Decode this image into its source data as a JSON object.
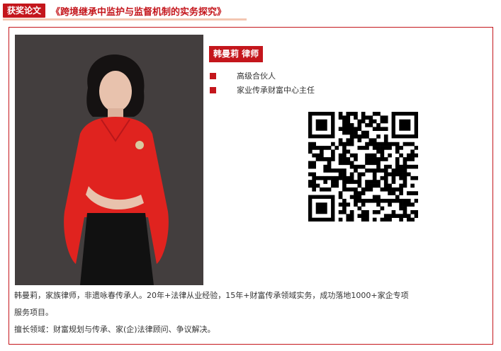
{
  "header": {
    "badge_label": "获奖论文",
    "article_title": "《跨境继承中监护与监督机制的实务探究》"
  },
  "profile": {
    "name_tag": "韩曼莉 律师",
    "roles": [
      "高级合伙人",
      "家业传承财富中心主任"
    ],
    "bio_line1": "韩曼莉，家族律师，非遗咏春传承人。20年+法律从业经验，15年+财富传承领域实务，成功落地1000+家企专项",
    "bio_line2": "服务项目。",
    "bio_line3": "擅长领域：财富规划与传承、家(企)法律顾问、争议解决。"
  },
  "colors": {
    "accent": "#c4161c",
    "photo_background": "#3f3b3b",
    "dress": "#e0231f",
    "skirt": "#111111"
  },
  "icons": {
    "qr": "qr-code-icon",
    "bullet": "square-bullet-icon"
  }
}
